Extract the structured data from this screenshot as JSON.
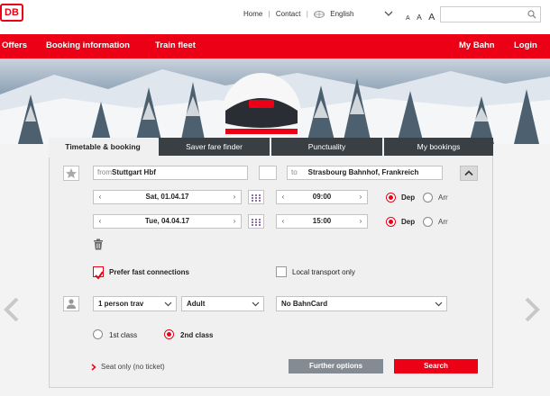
{
  "brand": {
    "logo_text": "DB",
    "accent": "#ec0016"
  },
  "topbar": {
    "links": [
      "Home",
      "Contact"
    ],
    "language": "English",
    "font_sizes": [
      "A",
      "A",
      "A"
    ],
    "search_placeholder": ""
  },
  "nav": {
    "left": [
      "Offers",
      "Booking information",
      "Train fleet"
    ],
    "right": [
      "My Bahn",
      "Login"
    ]
  },
  "tabs": [
    "Timetable & booking",
    "Saver fare finder",
    "Punctuality",
    "My bookings"
  ],
  "form": {
    "from_prefix": "from",
    "from_value": "Stuttgart Hbf",
    "to_prefix": "to",
    "to_value": "Strasbourg Bahnhof, Frankreich",
    "outbound": {
      "date": "Sat, 01.04.17",
      "time": "09:00",
      "dep_label": "Dep",
      "arr_label": "Arr",
      "selected": "Dep"
    },
    "return": {
      "date": "Tue, 04.04.17",
      "time": "15:00",
      "dep_label": "Dep",
      "arr_label": "Arr",
      "selected": "Dep"
    },
    "prefer_fast": {
      "label": "Prefer fast connections",
      "checked": true
    },
    "local_only": {
      "label": "Local transport only",
      "checked": false
    },
    "travellers": "1 person trav",
    "age_group": "Adult",
    "bahncard": "No BahnCard",
    "class_1": "1st class",
    "class_2": "2nd class",
    "selected_class": "2nd class",
    "seat_only": "Seat only (no ticket)",
    "further_options": "Further options",
    "search": "Search"
  }
}
